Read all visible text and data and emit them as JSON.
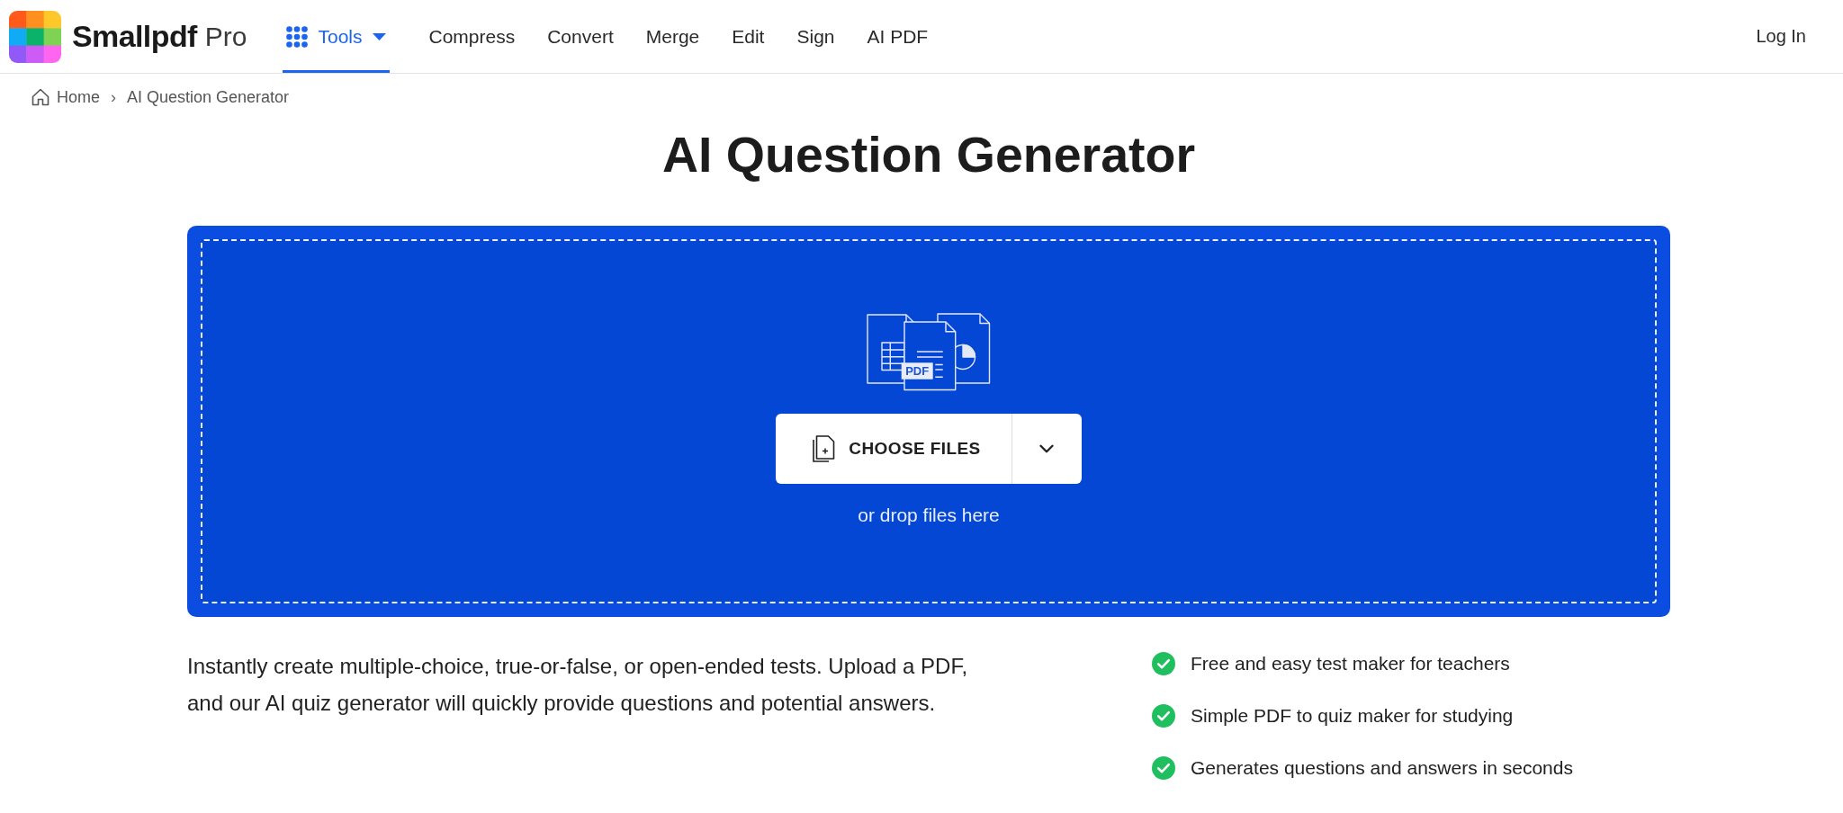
{
  "header": {
    "brand": {
      "name": "Smallpdf",
      "plan": "Pro"
    },
    "nav": [
      {
        "label": "Tools",
        "kind": "menu",
        "selected": true
      },
      {
        "label": "Compress",
        "kind": "link",
        "selected": false
      },
      {
        "label": "Convert",
        "kind": "link",
        "selected": false
      },
      {
        "label": "Merge",
        "kind": "link",
        "selected": false
      },
      {
        "label": "Edit",
        "kind": "link",
        "selected": false
      },
      {
        "label": "Sign",
        "kind": "link",
        "selected": false
      },
      {
        "label": "AI PDF",
        "kind": "link",
        "selected": false
      }
    ],
    "login": "Log In"
  },
  "breadcrumb": {
    "items": [
      {
        "label": "Home",
        "kind": "home"
      },
      {
        "label": "AI Question Generator",
        "kind": "current"
      }
    ],
    "separator": "›"
  },
  "title": "AI Question Generator",
  "upload": {
    "illustration_label": "PDF",
    "button": "CHOOSE FILES",
    "hint": "or drop files here"
  },
  "description": "Instantly create multiple-choice, true-or-false, or open-ended tests. Upload a PDF, and our AI quiz generator will quickly provide questions and potential answers.",
  "features": [
    "Free and easy test maker for teachers",
    "Simple PDF to quiz maker for studying",
    "Generates questions and answers in seconds"
  ]
}
